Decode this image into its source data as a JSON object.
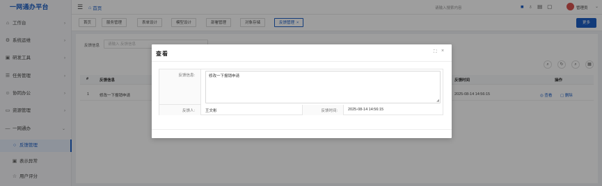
{
  "app": {
    "title": "一网通办平台"
  },
  "sidebar": {
    "items": [
      {
        "label": "工作台",
        "icon": "home-icon",
        "chevron": "›"
      },
      {
        "label": "系统运维",
        "icon": "gear-icon",
        "chevron": "›"
      },
      {
        "label": "研发工具",
        "icon": "wrench-icon",
        "chevron": "›"
      },
      {
        "label": "任务管理",
        "icon": "task-icon",
        "chevron": "›"
      },
      {
        "label": "协同办公",
        "icon": "people-icon",
        "chevron": "›"
      },
      {
        "label": "资源管理",
        "icon": "folder-icon",
        "chevron": "›"
      },
      {
        "label": "一网通办",
        "icon": "grid-icon",
        "chevron": "⌄"
      },
      {
        "label": "反馈管理",
        "icon": "feedback-icon",
        "active": true
      },
      {
        "label": "表示异常",
        "icon": "alert-icon"
      },
      {
        "label": "用户评分",
        "icon": "star-icon"
      }
    ]
  },
  "header": {
    "breadcrumb": "首页",
    "search_placeholder": "请输入搜索内容",
    "username": "管理员"
  },
  "tabs": {
    "items": [
      "首页",
      "服务管理",
      "表单设计",
      "模型设计",
      "部署管理",
      "对象存储"
    ],
    "active": "反馈管理",
    "active_close": "×",
    "more": "更多"
  },
  "filter": {
    "label": "反馈信息",
    "placeholder": "请输入 反馈信息"
  },
  "table": {
    "headers": {
      "index": "#",
      "info": "反馈信息",
      "time": "反馈时间",
      "ops": "操作"
    },
    "rows": [
      {
        "index": "1",
        "info": "修改一下报销申请",
        "time": "2025-08-14 14:56:15",
        "view": "查看",
        "delete": "删除"
      }
    ]
  },
  "dialog": {
    "title": "查看",
    "feedback_label": "反馈信息:",
    "feedback_value": "修改一下报销申请",
    "person_label": "反馈人:",
    "person_value": "王文彬",
    "time_label": "反馈时间:",
    "time_value": "2025-08-14 14:56:15"
  },
  "colors": {
    "accent": "#1d5fc5",
    "danger": "#d9534f"
  }
}
